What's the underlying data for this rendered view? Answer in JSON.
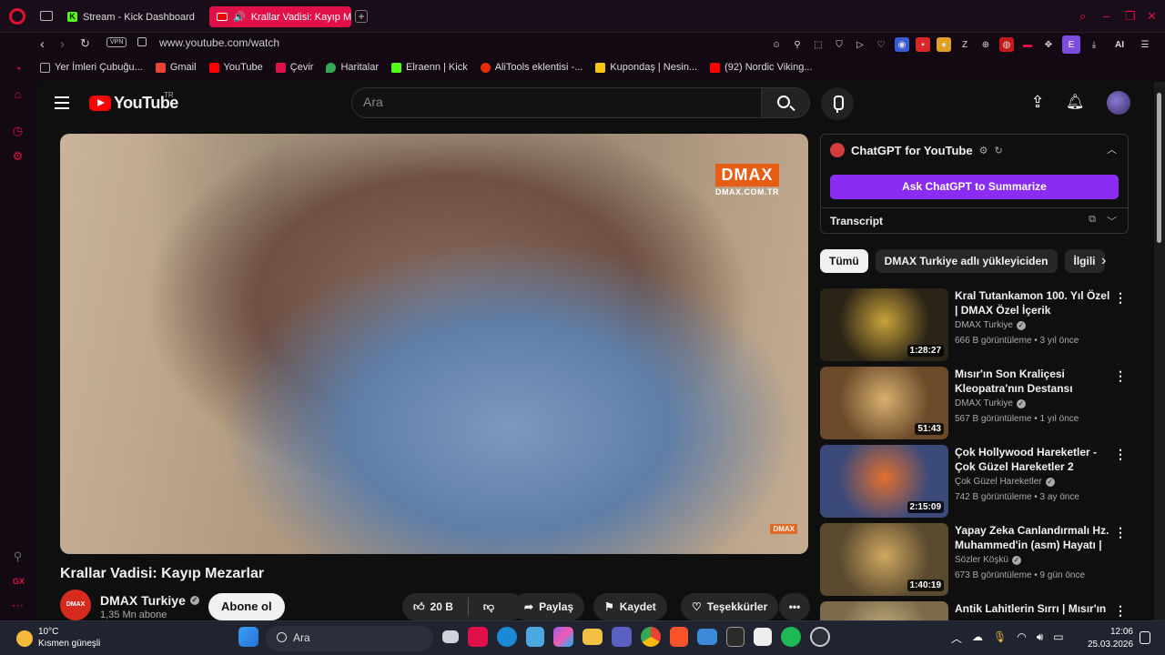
{
  "browser": {
    "tabs": [
      {
        "label": "Stream - Kick Dashboard"
      },
      {
        "label": "Krallar Vadisi: Kayıp Me"
      }
    ],
    "vpn_label": "VPN",
    "url": "www.youtube.com/watch",
    "ai_label": "AI",
    "ext_e_label": "E",
    "bookmarks": [
      {
        "label": "Yer İmleri Çubuğu...",
        "color": "#8c8c8c"
      },
      {
        "label": "Gmail",
        "color": "#ea4335"
      },
      {
        "label": "YouTube",
        "color": "#ff0000"
      },
      {
        "label": "Çevir",
        "color": "#e01148"
      },
      {
        "label": "Haritalar",
        "color": "#34a853"
      },
      {
        "label": "Elraenn | Kick",
        "color": "#53fc18"
      },
      {
        "label": "AliTools eklentisi -...",
        "color": "#e62e04"
      },
      {
        "label": "Kupondaş | Nesin...",
        "color": "#f5c518"
      },
      {
        "label": "(92) Nordic Viking...",
        "color": "#ff0000"
      }
    ],
    "sidebar_gx_label": "GX"
  },
  "youtube": {
    "logo_text": "YouTube",
    "region": "TR",
    "search_placeholder": "Ara",
    "video": {
      "title": "Krallar Vadisi: Kayıp Mezarlar",
      "watermark": "DMAX",
      "watermark_sub": "DMAX.COM.TR",
      "channel": "DMAX Turkiye",
      "channel_avatar_text": "DMAX",
      "subscribers": "1,35 Mn abone",
      "subscribe_label": "Abone ol",
      "likes": "20 B",
      "share_label": "Paylaş",
      "save_label": "Kaydet",
      "thanks_label": "Teşekkürler"
    },
    "chatgpt": {
      "title": "ChatGPT for YouTube",
      "button": "Ask ChatGPT to Summarize",
      "transcript": "Transcript"
    },
    "chips": [
      "Tümü",
      "DMAX Turkiye adlı yükleyiciden",
      "İlgili"
    ],
    "recommendations": [
      {
        "title": "Kral Tutankamon 100. Yıl Özel | DMAX Özel İçerik",
        "channel": "DMAX Turkiye",
        "meta": "666 B görüntüleme • 3 yıl önce",
        "duration": "1:28:27",
        "thumb_color": "#2a2416",
        "accent": "#c9a23a"
      },
      {
        "title": "Mısır'ın Son Kraliçesi Kleopatra'nın Destansı Hikaye...",
        "channel": "DMAX Turkiye",
        "meta": "567 B görüntüleme • 1 yıl önce",
        "duration": "51:43",
        "thumb_color": "#6b4a2a",
        "accent": "#d8b070"
      },
      {
        "title": "Çok Hollywood Hareketler - Çok Güzel Hareketler 2",
        "channel": "Çok Güzel Hareketler",
        "meta": "742 B görüntüleme • 3 ay önce",
        "duration": "2:15:09",
        "thumb_color": "#3c4a7a",
        "accent": "#e07030"
      },
      {
        "title": "Yapay Zeka Canlandırmalı Hz. Muhammed'in (asm) Hayatı | ...",
        "channel": "Sözler Köşkü",
        "meta": "673 B görüntüleme • 9 gün önce",
        "duration": "1:40:19",
        "thumb_color": "#5a4a30",
        "accent": "#d0a860"
      },
      {
        "title": "Antik Lahitlerin Sırrı | Mısır'ın",
        "channel": "",
        "meta": "",
        "duration": "",
        "thumb_color": "#7a6a4a",
        "accent": "#c8b080"
      }
    ]
  },
  "taskbar": {
    "temperature": "10°C",
    "weather": "Kısmen güneşli",
    "search_placeholder": "Ara",
    "time": "12:06",
    "date": "25.03.2026"
  }
}
